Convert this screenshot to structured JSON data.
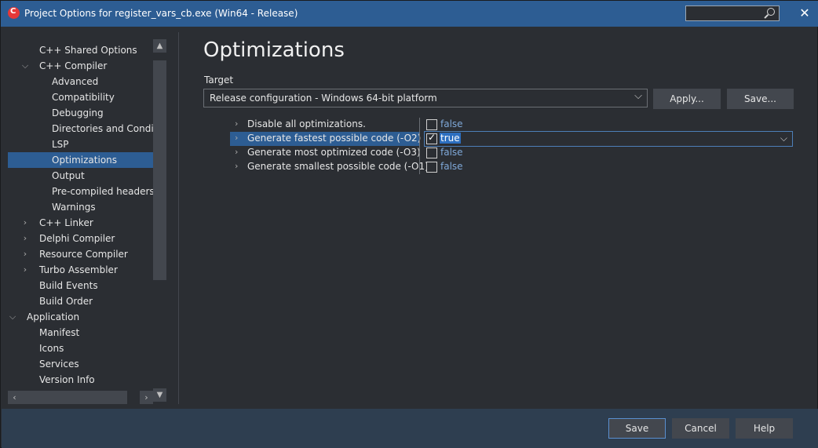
{
  "window": {
    "title": "Project Options for register_vars_cb.exe  (Win64 - Release)",
    "search_placeholder": ""
  },
  "tree": {
    "items": [
      {
        "label": "C++ Shared Options",
        "indent": 1,
        "expand": "none"
      },
      {
        "label": "C++ Compiler",
        "indent": 1,
        "expand": "expanded"
      },
      {
        "label": "Advanced",
        "indent": 2,
        "expand": "none"
      },
      {
        "label": "Compatibility",
        "indent": 2,
        "expand": "none"
      },
      {
        "label": "Debugging",
        "indent": 2,
        "expand": "none"
      },
      {
        "label": "Directories and Conditio",
        "indent": 2,
        "expand": "none"
      },
      {
        "label": "LSP",
        "indent": 2,
        "expand": "none"
      },
      {
        "label": "Optimizations",
        "indent": 2,
        "expand": "none",
        "selected": true
      },
      {
        "label": "Output",
        "indent": 2,
        "expand": "none"
      },
      {
        "label": "Pre-compiled headers",
        "indent": 2,
        "expand": "none"
      },
      {
        "label": "Warnings",
        "indent": 2,
        "expand": "none"
      },
      {
        "label": "C++ Linker",
        "indent": 1,
        "expand": "collapsed"
      },
      {
        "label": "Delphi Compiler",
        "indent": 1,
        "expand": "collapsed"
      },
      {
        "label": "Resource Compiler",
        "indent": 1,
        "expand": "collapsed"
      },
      {
        "label": "Turbo Assembler",
        "indent": 1,
        "expand": "collapsed"
      },
      {
        "label": "Build Events",
        "indent": 1,
        "expand": "none"
      },
      {
        "label": "Build Order",
        "indent": 1,
        "expand": "none"
      },
      {
        "label": "Application",
        "indent": 0,
        "expand": "expanded"
      },
      {
        "label": "Manifest",
        "indent": 1,
        "expand": "none"
      },
      {
        "label": "Icons",
        "indent": 1,
        "expand": "none"
      },
      {
        "label": "Services",
        "indent": 1,
        "expand": "none"
      },
      {
        "label": "Version Info",
        "indent": 1,
        "expand": "none"
      }
    ]
  },
  "main": {
    "title": "Optimizations",
    "target_label": "Target",
    "target_value": "Release configuration - Windows 64-bit platform",
    "apply_label": "Apply...",
    "save_label": "Save...",
    "options": [
      {
        "name": "Disable all optimizations.",
        "value": "false",
        "checked": false,
        "selected": false
      },
      {
        "name": "Generate fastest possible code (-O2)",
        "value": "true",
        "checked": true,
        "selected": true
      },
      {
        "name": "Generate most optimized code (-O3)",
        "value": "false",
        "checked": false,
        "selected": false
      },
      {
        "name": "Generate smallest possible code (-O1)",
        "value": "false",
        "checked": false,
        "selected": false
      }
    ]
  },
  "footer": {
    "save": "Save",
    "cancel": "Cancel",
    "help": "Help"
  },
  "colors": {
    "titlebar": "#2d5d93",
    "selection": "#2d5d93",
    "value_text": "#7fa8d8"
  }
}
